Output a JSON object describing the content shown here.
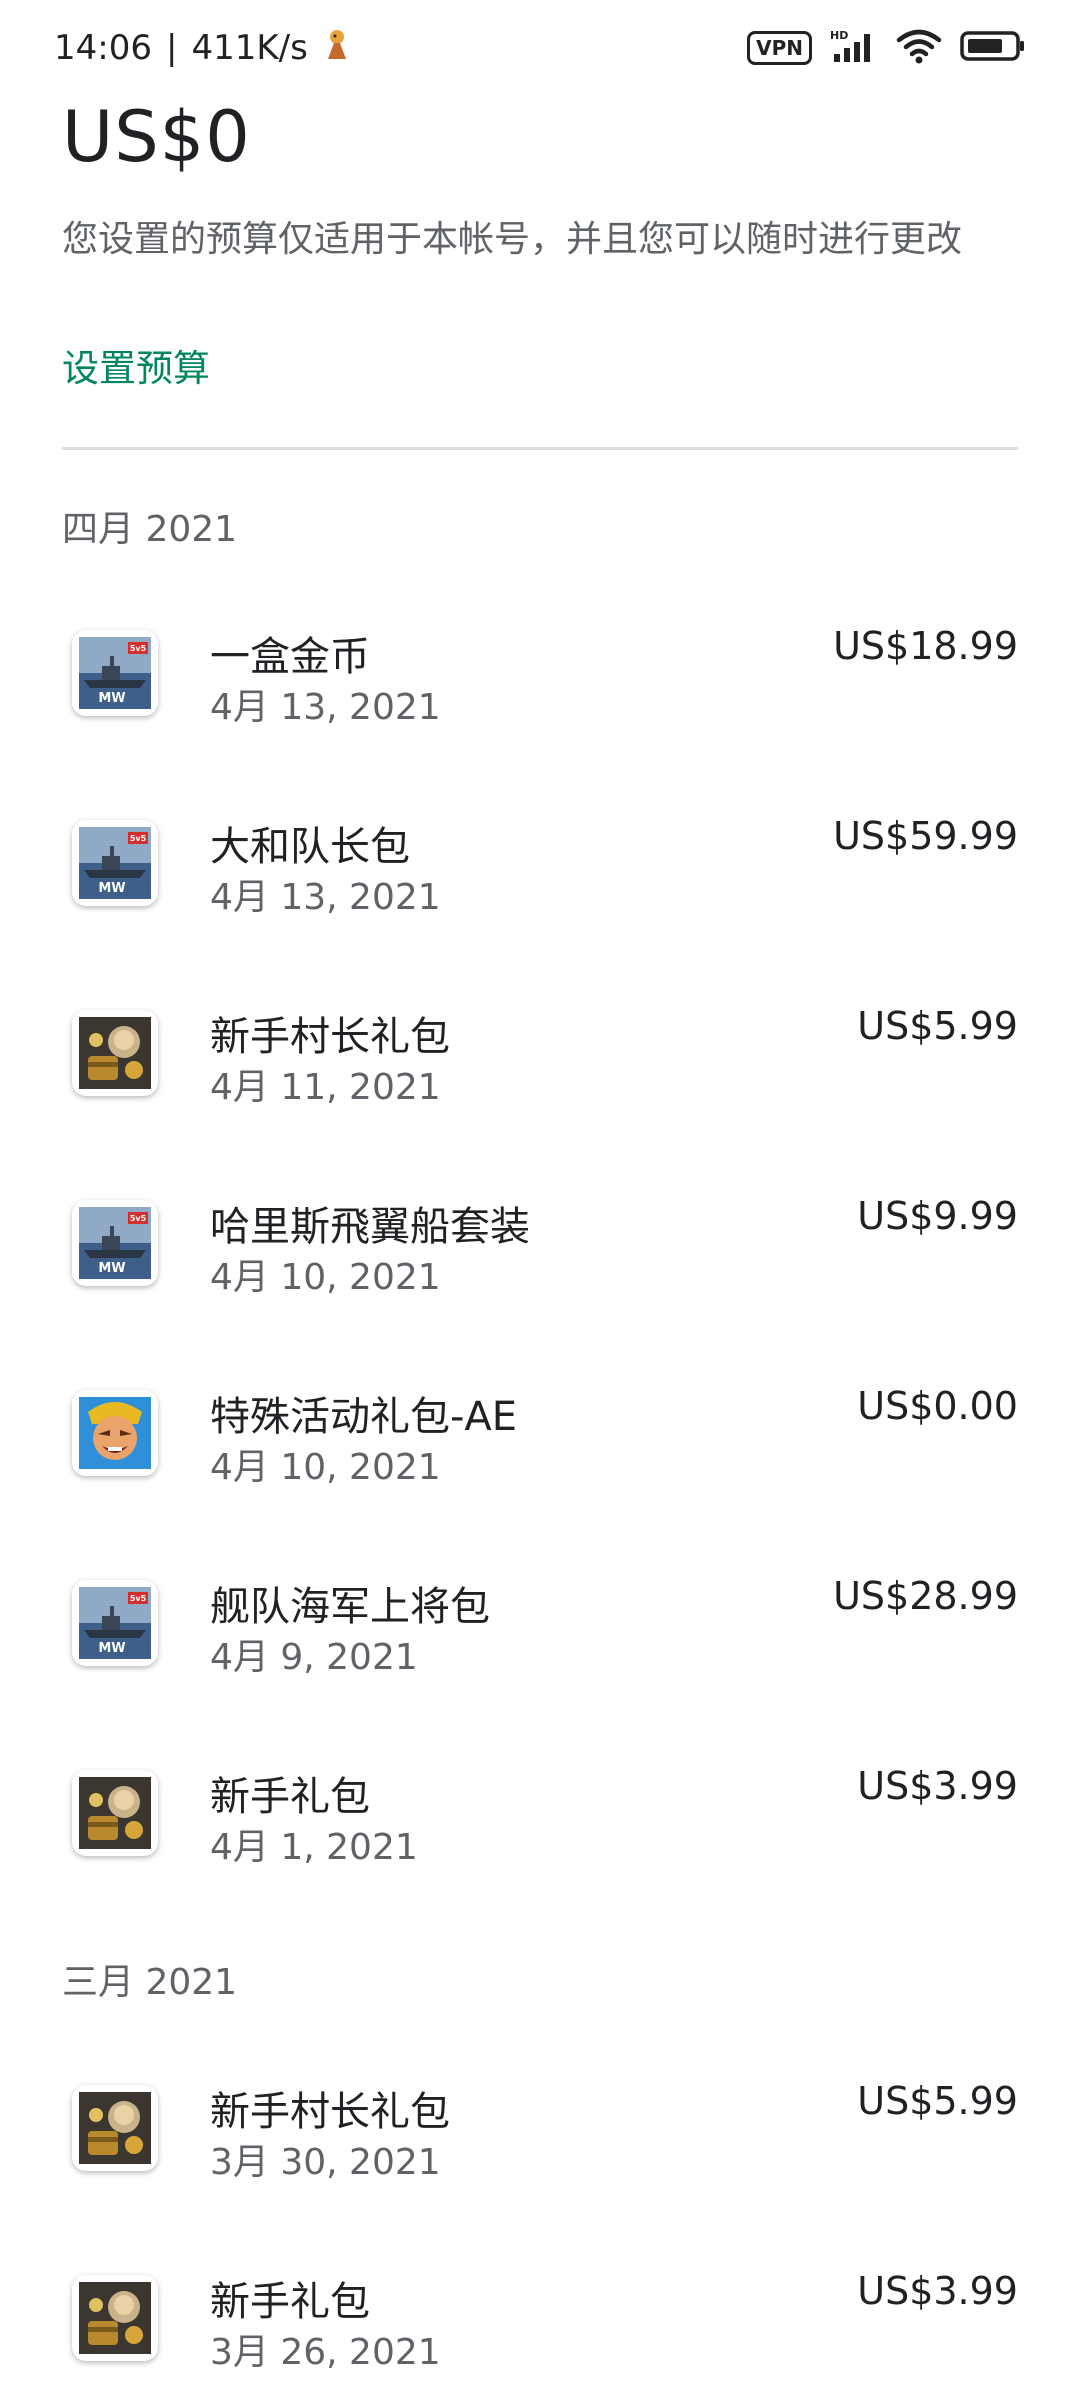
{
  "status_bar": {
    "time": "14:06",
    "separator": "|",
    "speed": "411K/s",
    "vpn": "VPN",
    "hd": "HD"
  },
  "budget": {
    "amount": "US$0",
    "note": "您设置的预算仅适用于本帐号，并且您可以随时进行更改",
    "action": "设置预算"
  },
  "sections": [
    {
      "header": "四月 2021"
    },
    {
      "header": "三月 2021"
    }
  ],
  "transactions": [
    {
      "title": "一盒金币",
      "date": "4月 13, 2021",
      "price": "US$18.99",
      "icon": "modern-warships-app-icon"
    },
    {
      "title": "大和队长包",
      "date": "4月 13, 2021",
      "price": "US$59.99",
      "icon": "modern-warships-app-icon"
    },
    {
      "title": "新手村长礼包",
      "date": "4月 11, 2021",
      "price": "US$5.99",
      "icon": "chest-hero-app-icon"
    },
    {
      "title": "哈里斯飛翼船套装",
      "date": "4月 10, 2021",
      "price": "US$9.99",
      "icon": "modern-warships-app-icon"
    },
    {
      "title": "特殊活动礼包-AE",
      "date": "4月 10, 2021",
      "price": "US$0.00",
      "icon": "warrior-face-app-icon"
    },
    {
      "title": "舰队海军上将包",
      "date": "4月 9, 2021",
      "price": "US$28.99",
      "icon": "modern-warships-app-icon"
    },
    {
      "title": "新手礼包",
      "date": "4月 1, 2021",
      "price": "US$3.99",
      "icon": "chest-hero-app-icon"
    },
    {
      "title": "新手村长礼包",
      "date": "3月 30, 2021",
      "price": "US$5.99",
      "icon": "chest-hero-app-icon"
    },
    {
      "title": "新手礼包",
      "date": "3月 26, 2021",
      "price": "US$3.99",
      "icon": "chest-hero-app-icon"
    }
  ],
  "colors": {
    "accent": "#01875f",
    "secondary_text": "#5f6368",
    "primary_text": "#202124",
    "divider": "#dadce0"
  }
}
